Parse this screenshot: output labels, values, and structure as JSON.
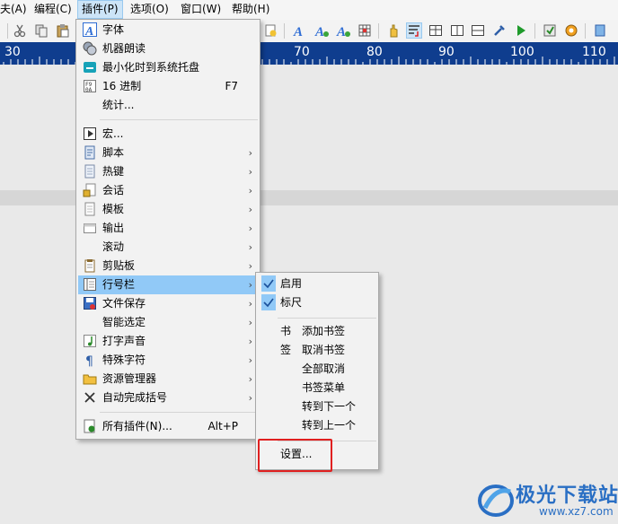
{
  "menubar": {
    "items": [
      {
        "label": "夫(A)"
      },
      {
        "label": "编程(C)"
      },
      {
        "label": "插件(P)"
      },
      {
        "label": "选项(O)"
      },
      {
        "label": "窗口(W)"
      },
      {
        "label": "帮助(H)"
      }
    ]
  },
  "ruler": {
    "numbers": [
      "30",
      "70",
      "80",
      "90",
      "100",
      "110"
    ]
  },
  "plugin_menu": {
    "items": [
      {
        "label": "字体",
        "icon": "font-a-icon"
      },
      {
        "label": "机器朗读",
        "icon": "speaker-icon"
      },
      {
        "label": "最小化时到系统托盘",
        "icon": "tray-icon"
      },
      {
        "label": "16 进制",
        "shortcut": "F7",
        "icon": "hex-icon"
      },
      {
        "label": "统计..."
      },
      {
        "label": "宏...",
        "icon": "macro-play-icon"
      },
      {
        "label": "脚本",
        "icon": "script-icon"
      },
      {
        "label": "热键",
        "icon": "hotkey-icon"
      },
      {
        "label": "会话",
        "icon": "session-lock-icon"
      },
      {
        "label": "模板",
        "icon": "template-icon"
      },
      {
        "label": "输出",
        "icon": "output-icon"
      },
      {
        "label": "滚动"
      },
      {
        "label": "剪贴板",
        "icon": "clipboard-icon"
      },
      {
        "label": "行号栏",
        "icon": "line-numbers-icon"
      },
      {
        "label": "文件保存",
        "icon": "save-disk-icon"
      },
      {
        "label": "智能选定"
      },
      {
        "label": "打字声音",
        "icon": "music-note-icon"
      },
      {
        "label": "特殊字符",
        "icon": "pilcrow-icon"
      },
      {
        "label": "资源管理器",
        "icon": "folder-icon"
      },
      {
        "label": "自动完成括号",
        "icon": "brackets-icon"
      },
      {
        "label": "所有插件(N)...",
        "shortcut": "Alt+P",
        "icon": "plugins-icon"
      }
    ]
  },
  "submenu": {
    "items": [
      {
        "label": "启用",
        "checked": true
      },
      {
        "label": "标尺",
        "checked": true
      },
      {
        "prefix": "书",
        "label": "添加书签"
      },
      {
        "prefix": "签",
        "label": "取消书签"
      },
      {
        "label": "全部取消"
      },
      {
        "label": "书签菜单"
      },
      {
        "label": "转到下一个"
      },
      {
        "label": "转到上一个"
      },
      {
        "label": "设置..."
      }
    ]
  },
  "watermark": {
    "title": "极光下载站",
    "url": "www.xz7.com"
  },
  "colors": {
    "ruler": "#0f3d8e",
    "highlight": "#91c9f7",
    "annotation": "#e02020"
  }
}
